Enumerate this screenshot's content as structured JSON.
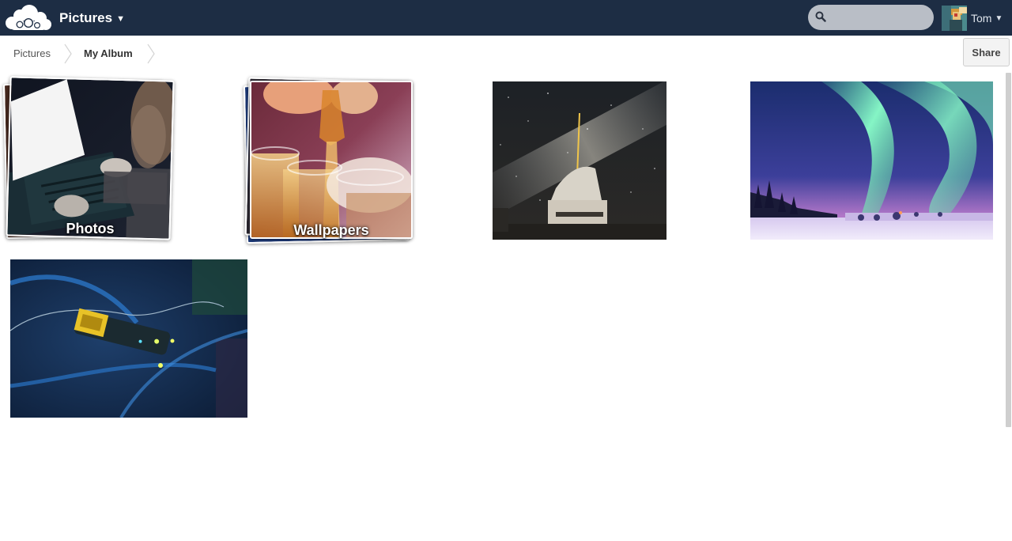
{
  "header": {
    "app_name": "Pictures",
    "search": {
      "placeholder": "",
      "value": ""
    },
    "user": {
      "name": "Tom"
    },
    "colors": {
      "bar": "#1d2d44",
      "search_bg": "#b9bec6"
    }
  },
  "breadcrumb": {
    "items": [
      {
        "label": "Pictures"
      },
      {
        "label": "My Album"
      }
    ]
  },
  "actions": {
    "share_label": "Share"
  },
  "gallery": {
    "albums": [
      {
        "label": "Photos"
      },
      {
        "label": "Wallpapers"
      }
    ],
    "photos": [
      {
        "subject": "milky-way-observatory"
      },
      {
        "subject": "aurora-borealis"
      },
      {
        "subject": "circuit-board"
      }
    ]
  }
}
